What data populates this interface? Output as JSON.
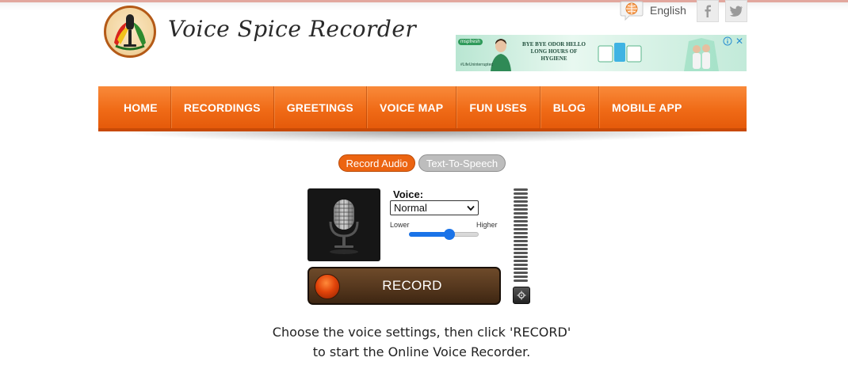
{
  "header": {
    "logo_text": "Voice Spice Recorder",
    "language_label": "English"
  },
  "ad": {
    "brand": "mspfresh",
    "headline": "BYE BYE ODOR HELLO LONG HOURS OF HYGIENE",
    "hashtag": "#LifeUninterrupted"
  },
  "nav": {
    "items": [
      {
        "label": "HOME"
      },
      {
        "label": "RECORDINGS"
      },
      {
        "label": "GREETINGS"
      },
      {
        "label": "VOICE MAP"
      },
      {
        "label": "FUN USES"
      },
      {
        "label": "BLOG"
      },
      {
        "label": "MOBILE APP"
      }
    ]
  },
  "modes": {
    "record_audio": "Record Audio",
    "text_to_speech": "Text-To-Speech"
  },
  "recorder": {
    "voice_label": "Voice:",
    "voice_selected": "Normal",
    "pitch_lower": "Lower",
    "pitch_higher": "Higher",
    "pitch_value_fraction": 0.58,
    "record_label": "RECORD"
  },
  "instructions": {
    "line1": "Choose the voice settings, then click 'RECORD'",
    "line2": "to start the Online Voice Recorder."
  },
  "colors": {
    "nav_orange": "#f06b17",
    "record_tab": "#ec6411",
    "tts_tab": "#bdbdbd",
    "slider_blue": "#1a73e8"
  }
}
